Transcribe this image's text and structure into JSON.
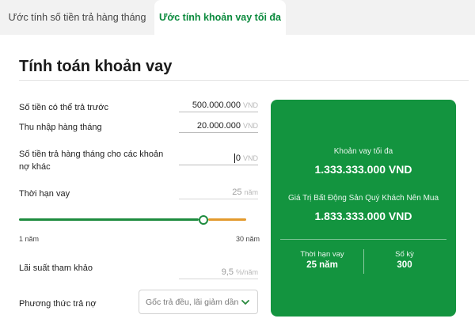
{
  "tabs": [
    {
      "label": "Ước tính số tiền trả hàng tháng",
      "active": false
    },
    {
      "label": "Ước tính khoản vay tối đa",
      "active": true
    }
  ],
  "title": "Tính toán khoản vay",
  "form": {
    "savings": {
      "label": "Số tiền có thể trả trước",
      "value": "500.000.000",
      "unit": "VND"
    },
    "income": {
      "label": "Thu nhập hàng tháng",
      "value": "20.000.000",
      "unit": "VND"
    },
    "other_debt": {
      "label": "Số tiền trả hàng tháng cho các khoản nợ khác",
      "value": "0",
      "unit": "VND"
    },
    "term": {
      "label": "Thời hạn vay",
      "value": "25",
      "unit": "năm",
      "min_label": "1 năm",
      "max_label": "30 năm",
      "min": 1,
      "max": 30,
      "current": 25
    },
    "rate": {
      "label": "Lãi suất tham khảo",
      "value": "9,5",
      "unit": "%/năm"
    },
    "method": {
      "label": "Phương thức trả nợ",
      "selected": "Gốc trả đều, lãi giảm dần"
    }
  },
  "result": {
    "max_loan_label": "Khoản vay tối đa",
    "max_loan_value": "1.333.333.000 VND",
    "property_label": "Giá Trị Bất Động Sản Quý Khách Nên Mua",
    "property_value": "1.833.333.000 VND",
    "term_label": "Thời hạn vay",
    "term_value": "25 năm",
    "periods_label": "Số kỳ",
    "periods_value": "300"
  },
  "colors": {
    "brand_green": "#13943f",
    "slider_green": "#1d8b3e",
    "slider_orange": "#e39a2d"
  },
  "icons": {
    "select_arrow": "chevron-down-icon"
  }
}
